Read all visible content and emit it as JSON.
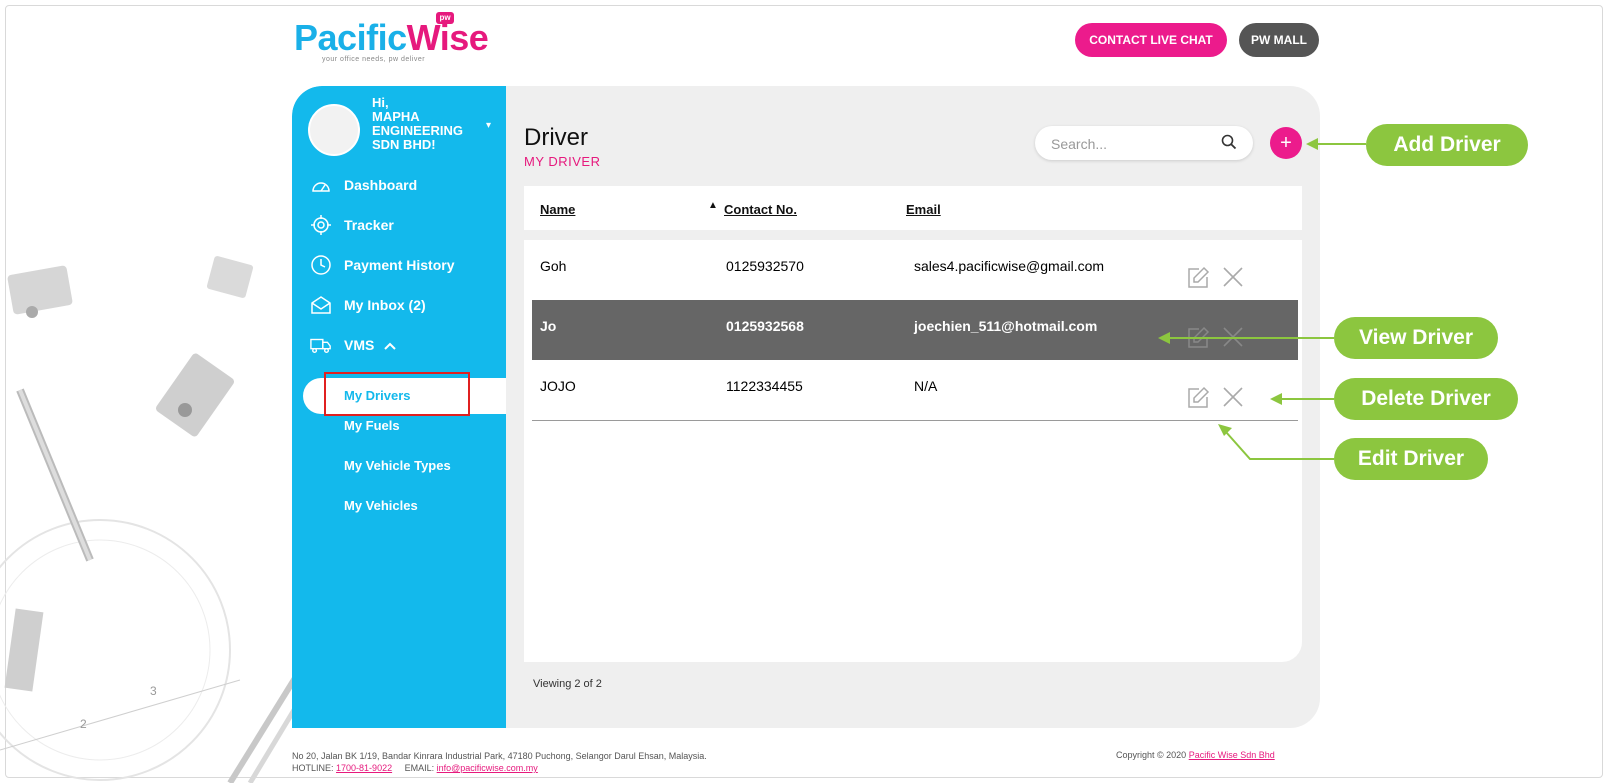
{
  "brand": {
    "logo_part1": "Pac",
    "logo_i": "i",
    "logo_part2": "fic",
    "logo_part3": "Wise",
    "logo_badge": "pw",
    "tagline": "your office needs, pw deliver",
    "primary_color": "#13b9ec",
    "accent_color": "#ec1b8c"
  },
  "header": {
    "chat_label": "CONTACT LIVE CHAT",
    "mall_label": "PW MALL"
  },
  "user": {
    "greeting": "Hi,",
    "company_line1": "MAPHA",
    "company_line2": "ENGINEERING",
    "company_line3": "SDN BHD!"
  },
  "sidebar": {
    "items": [
      {
        "label": "Dashboard",
        "icon": "gauge-icon"
      },
      {
        "label": "Tracker",
        "icon": "crosshair-icon"
      },
      {
        "label": "Payment History",
        "icon": "clock-icon"
      },
      {
        "label": "My Inbox (2)",
        "icon": "envelope-icon"
      },
      {
        "label": "VMS",
        "icon": "truck-icon"
      }
    ],
    "vms_submenu": [
      {
        "label": "My Drivers",
        "active": true
      },
      {
        "label": "My Fuels"
      },
      {
        "label": "My Vehicle Types"
      },
      {
        "label": "My Vehicles"
      }
    ]
  },
  "page": {
    "title": "Driver",
    "subtitle": "MY DRIVER",
    "search_placeholder": "Search...",
    "add_label": "+"
  },
  "table": {
    "columns": [
      "Name",
      "Contact No.",
      "Email"
    ],
    "rows": [
      {
        "name": "Goh",
        "contact": "0125932570",
        "email": "sales4.pacificwise@gmail.com"
      },
      {
        "name": "Jo",
        "contact": "0125932568",
        "email": "joechien_511@hotmail.com",
        "highlighted": true
      },
      {
        "name": "JOJO",
        "contact": "1122334455",
        "email": "N/A"
      }
    ],
    "viewing": "Viewing 2 of 2"
  },
  "footer": {
    "address": "No 20, Jalan BK 1/19, Bandar Kinrara Industrial Park, 47180 Puchong, Selangor Darul Ehsan, Malaysia.",
    "hotline_label": "HOTLINE:",
    "hotline": "1700-81-9022",
    "email_label": "EMAIL:",
    "email": "info@pacificwise.com.my",
    "copyright": "Copyright © 2020",
    "company_link": "Pacific Wise Sdn Bhd"
  },
  "annotations": {
    "add_driver": "Add  Driver",
    "view_driver": "View Driver",
    "delete_driver": "Delete Driver",
    "edit_driver": "Edit Driver",
    "color": "#8cc63f"
  }
}
